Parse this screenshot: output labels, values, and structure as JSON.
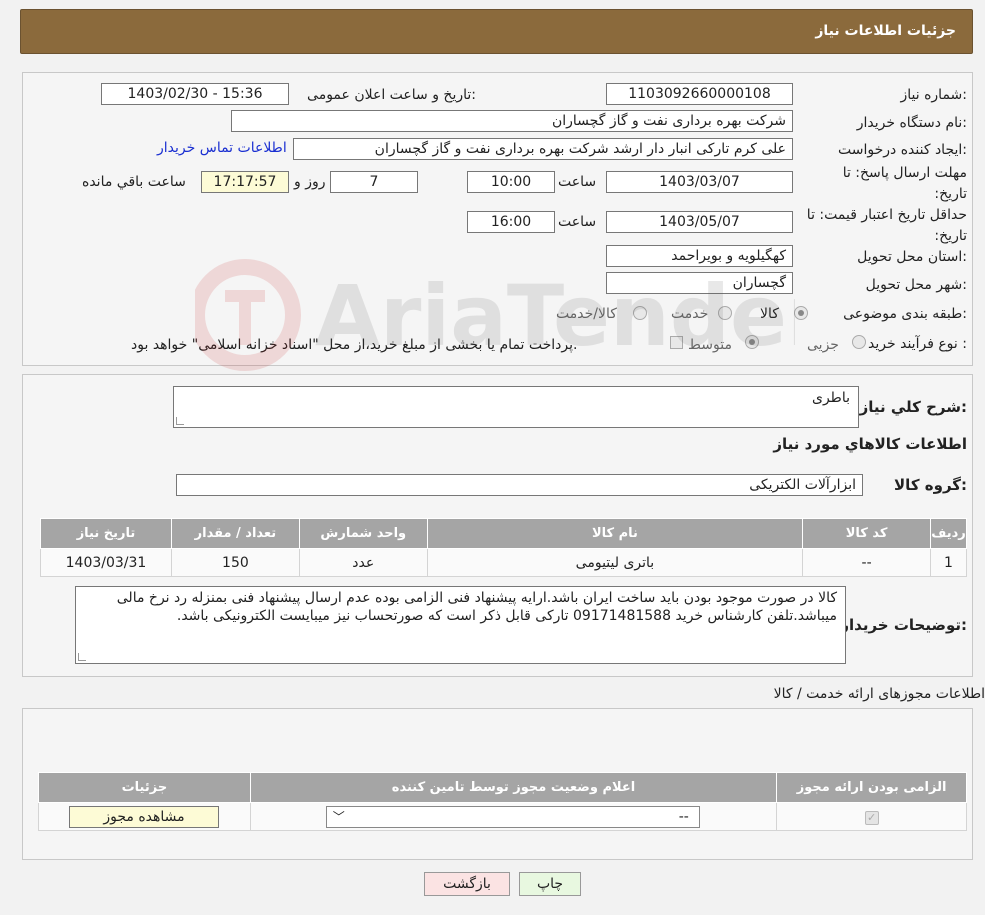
{
  "header": {
    "title": "جزئیات اطلاعات نیاز"
  },
  "form": {
    "need_number_label": "شماره نیاز:",
    "need_number": "1103092660000108",
    "announce_label": "تاریخ و ساعت اعلان عمومی:",
    "announce_value": "1403/02/30 - 15:36",
    "buyer_label": "نام دستگاه خریدار:",
    "buyer_value": "شرکت بهره برداری نفت و گاز گچساران",
    "creator_label": "ایجاد کننده درخواست:",
    "creator_value": "علی کرم تارکی انبار دار ارشد شرکت بهره برداری نفت و گاز گچساران",
    "contact_link": "اطلاعات تماس خریدار",
    "reply_deadline_label": "مهلت ارسال پاسخ: تا تاریخ:",
    "reply_date": "1403/03/07",
    "time_label": "ساعت",
    "reply_time": "10:00",
    "days_value": "7",
    "days_label": "روز و",
    "remaining_time": "17:17:57",
    "remaining_label": "ساعت باقي مانده",
    "validity_label": "حداقل تاریخ اعتبار قیمت: تا تاریخ:",
    "validity_date": "1403/05/07",
    "validity_time": "16:00",
    "province_label": "استان محل تحویل:",
    "province_value": "کهگیلویه و بویراحمد",
    "city_label": "شهر محل تحویل:",
    "city_value": "گچساران",
    "category_label": "طبقه بندی موضوعی:",
    "category_options": [
      "کالا",
      "خدمت",
      "کالا/خدمت"
    ],
    "purchase_label": "نوع فرآیند خرید :",
    "purchase_options": [
      "جزیی",
      "متوسط"
    ],
    "purchase_note": "پرداخت تمام یا بخشی از مبلغ خرید،از محل \"اسناد خزانه اسلامی\" خواهد بود."
  },
  "details": {
    "summary_label": "شرح کلي نياز:",
    "summary_value": "باطری",
    "goods_title": "اطلاعات کالاهاي مورد نياز",
    "group_label": "گروه کالا:",
    "group_value": "ابزارآلات الکتریکی",
    "table_headers": [
      "رديف",
      "کد کالا",
      "نام کالا",
      "واحد شمارش",
      "تعداد / مقدار",
      "تاريخ نياز"
    ],
    "table_rows": [
      [
        "1",
        "--",
        "باتری لیتیومی",
        "عدد",
        "150",
        "1403/03/31"
      ]
    ],
    "buyer_notes_label": "توضیحات خریدار:",
    "buyer_notes": "کالا در صورت موجود بودن باید ساخت ایران باشد.ارایه پیشنهاد فنی الزامی بوده عدم ارسال پیشنهاد فنی بمنزله رد نرخ مالی میباشد.تلفن کارشناس خرید 09171481588 تارکی قابل ذکر است که صورتحساب نیز میبایست الکترونیکی باشد."
  },
  "permits": {
    "title": "اطلاعات مجوزهای ارائه خدمت / کالا",
    "headers": [
      "الزامی بودن ارائه مجوز",
      "اعلام وضعیت مجوز توسط تامین کننده",
      "جزئیات"
    ],
    "select_value": "--",
    "view_button": "مشاهده مجوز"
  },
  "buttons": {
    "print": "چاپ",
    "back": "بازگشت"
  },
  "watermark": {
    "text": "AriaTender.neT"
  }
}
